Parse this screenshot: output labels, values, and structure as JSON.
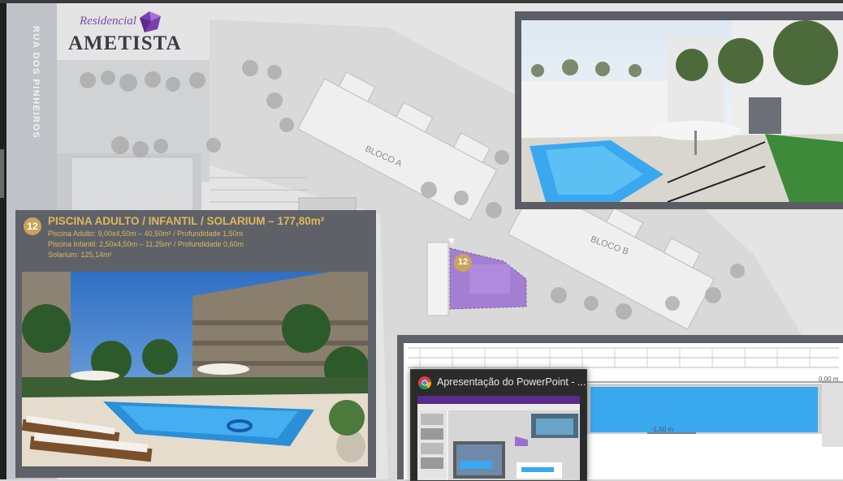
{
  "logo": {
    "script_text": "Residencial",
    "name_text": "AMETISTA"
  },
  "map": {
    "street_label": "RUA DOS PINHEIROS",
    "block_a_label": "BLOCO A",
    "block_b_label": "BLOCO B",
    "pool_marker_number": "12"
  },
  "info": {
    "badge_number": "12",
    "title": "PISCINA ADULTO / INFANTIL / SOLARIUM – 177,80m²",
    "lines": [
      "Piscina Adulto: 9,00x4,50m – 40,50m² / Profundidade 1,50m",
      "Piscina Infantil: 2,50x4,50m – 11,25m² / Profundidade 0,60m",
      "Solarium: 125,14m²"
    ]
  },
  "section": {
    "level_top": "0,00 m",
    "level_depth": "-1,50 m"
  },
  "taskbar_preview": {
    "window_title": "Apresentação do PowerPoint - ..."
  },
  "colors": {
    "accent_gold": "#e0b65c",
    "badge_gold": "#c9a45a",
    "panel_gray": "#5e6268",
    "highlight_purple": "#9b6fd1",
    "pool_blue": "#3aa8ef"
  }
}
